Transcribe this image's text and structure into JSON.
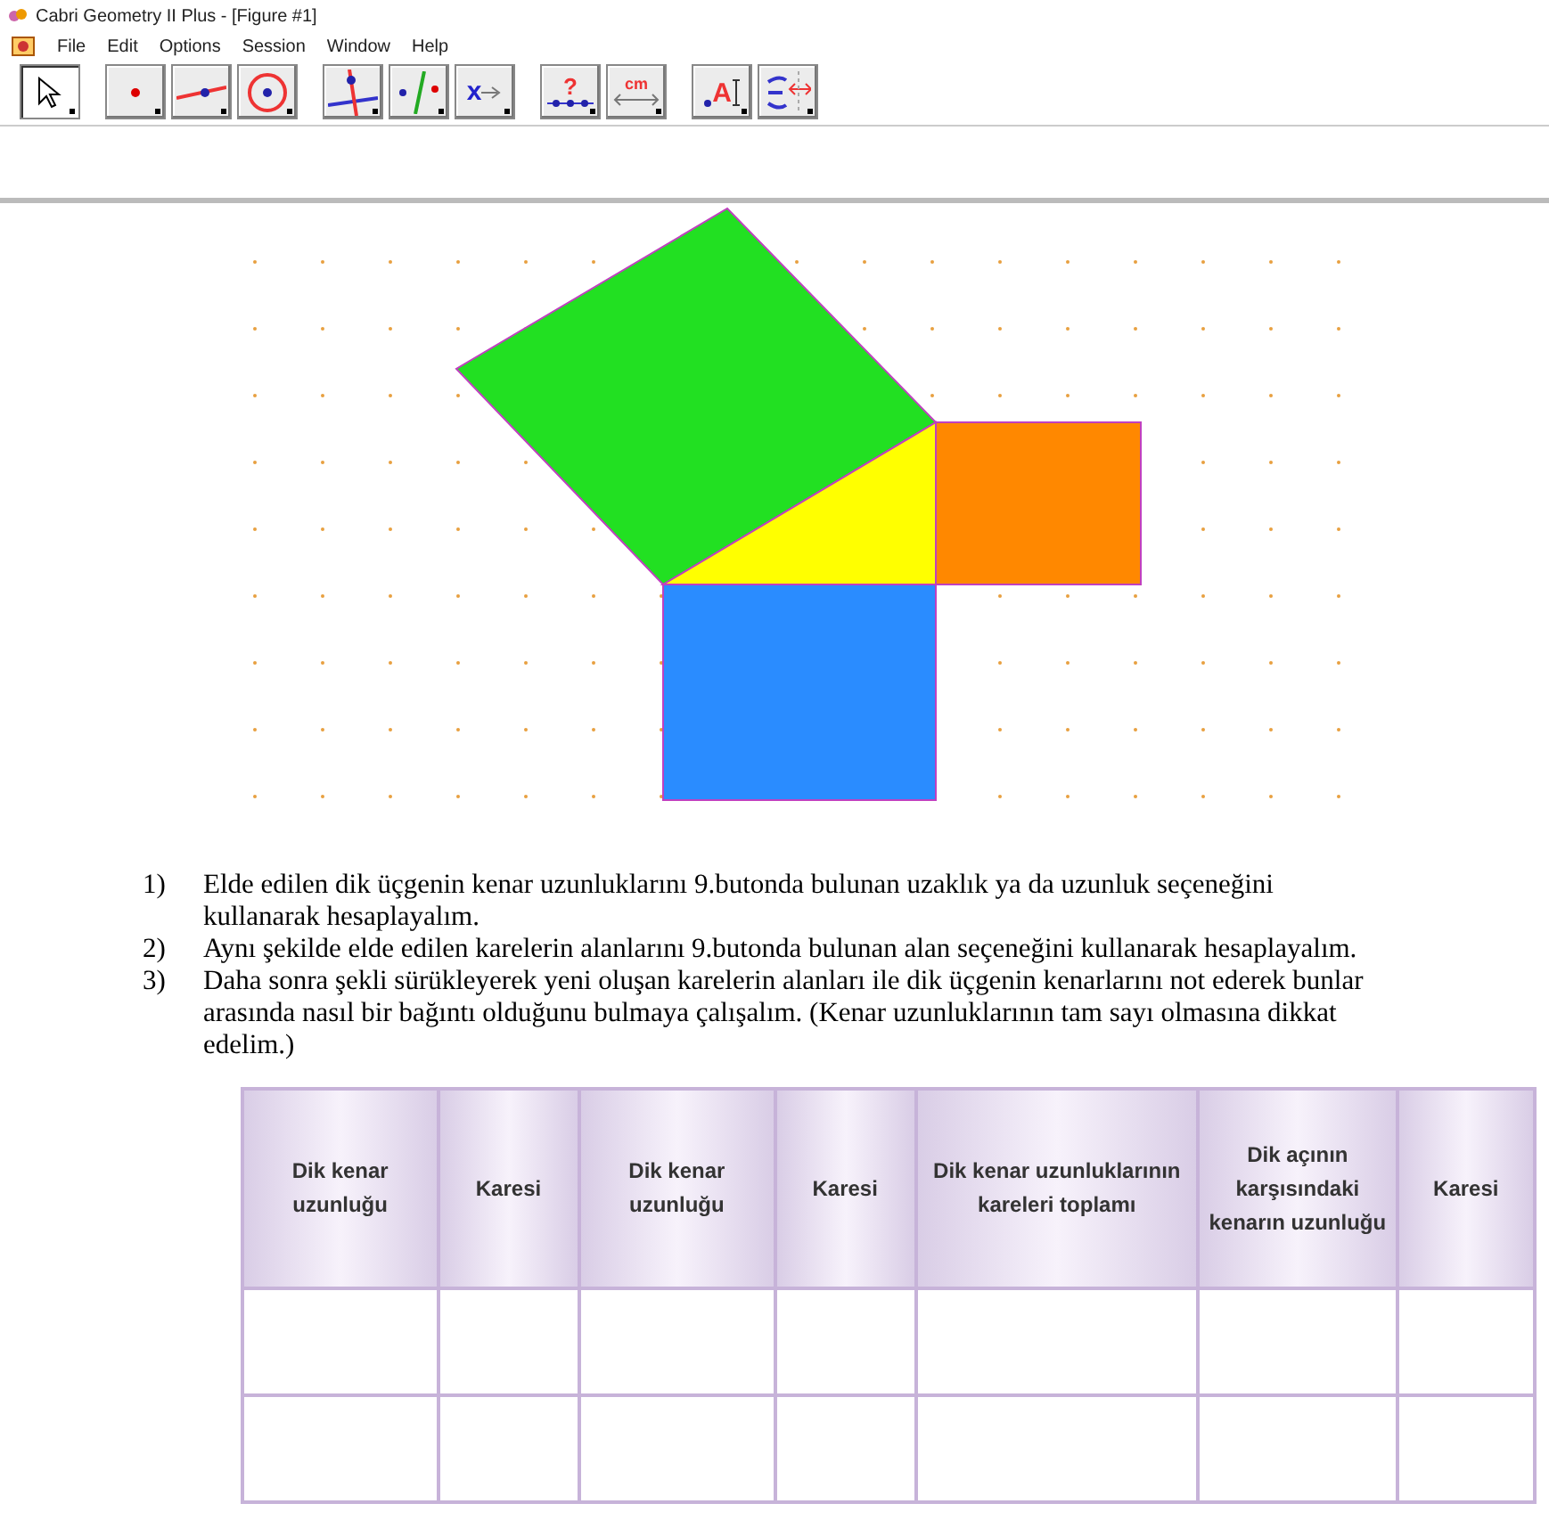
{
  "window": {
    "title": "Cabri Geometry II Plus - [Figure #1]"
  },
  "menu": [
    "File",
    "Edit",
    "Options",
    "Session",
    "Window",
    "Help"
  ],
  "toolbar": [
    [
      {
        "kind": "pointer",
        "selected": true
      }
    ],
    [
      {
        "kind": "point",
        "selected": false
      },
      {
        "kind": "line",
        "selected": false
      },
      {
        "kind": "circle",
        "selected": false
      }
    ],
    [
      {
        "kind": "perpendicular",
        "selected": false
      },
      {
        "kind": "symmetry",
        "selected": false
      },
      {
        "kind": "transform",
        "selected": false,
        "glyph": "x"
      }
    ],
    [
      {
        "kind": "check",
        "selected": false,
        "glyph": "?"
      },
      {
        "kind": "measure",
        "selected": false,
        "glyph": "cm"
      }
    ],
    [
      {
        "kind": "text",
        "selected": false,
        "glyph": "A"
      },
      {
        "kind": "display",
        "selected": false
      }
    ]
  ],
  "steps": [
    {
      "number": "1)",
      "text": "Elde edilen dik üçgenin kenar uzunluklarını 9.butonda bulunan uzaklık ya da uzunluk seçeneğini kullanarak hesaplayalım."
    },
    {
      "number": "2)",
      "text": "Aynı şekilde elde edilen karelerin alanlarını 9.butonda bulunan alan seçeneğini kullanarak hesaplayalım."
    },
    {
      "number": "3)",
      "text": "Daha sonra şekli sürükleyerek yeni oluşan karelerin alanları ile dik üçgenin kenarlarını not ederek bunlar arasında nasıl bir bağıntı olduğunu bulmaya çalışalım. (Kenar uzunluklarının tam sayı olmasına dikkat edelim.)"
    }
  ],
  "table": {
    "columns": [
      "Dik kenar uzunluğu",
      "Karesi",
      "Dik kenar uzunluğu",
      "Karesi",
      "Dik kenar uzunluklarının kareleri toplamı",
      "Dik açının karşısındaki kenarın uzunluğu",
      "Karesi"
    ]
  }
}
